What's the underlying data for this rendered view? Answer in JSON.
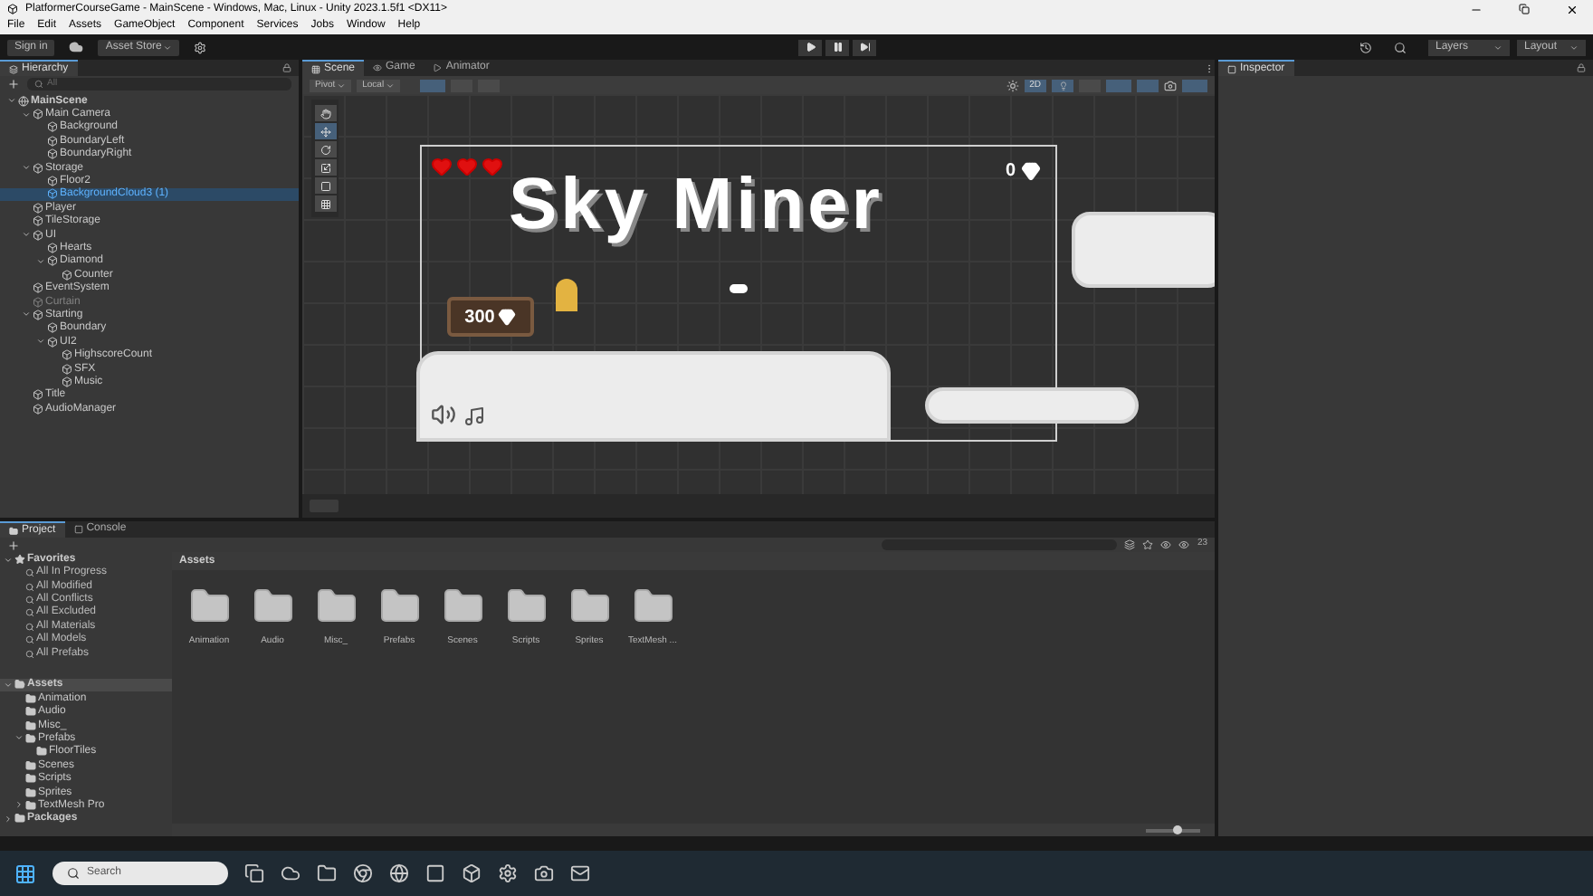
{
  "window": {
    "title": "PlatformerCourseGame - MainScene - Windows, Mac, Linux - Unity 2023.1.5f1 <DX11>"
  },
  "menu": [
    "File",
    "Edit",
    "Assets",
    "GameObject",
    "Component",
    "Services",
    "Jobs",
    "Window",
    "Help"
  ],
  "toolbar": {
    "sign_in": "Sign in",
    "asset_store": "Asset Store",
    "layers": "Layers",
    "layout": "Layout"
  },
  "hierarchy": {
    "tab": "Hierarchy",
    "search_placeholder": "All",
    "tree": [
      {
        "name": "MainScene",
        "kind": "scene",
        "expanded": true,
        "selected": false,
        "active": true,
        "children": [
          {
            "name": "Main Camera",
            "expanded": true,
            "selected": false,
            "active": true,
            "children": [
              {
                "name": "Background",
                "selected": false,
                "active": true
              },
              {
                "name": "BoundaryLeft",
                "selected": false,
                "active": true
              },
              {
                "name": "BoundaryRight",
                "selected": false,
                "active": true
              }
            ]
          },
          {
            "name": "Storage",
            "expanded": true,
            "selected": false,
            "active": true,
            "children": [
              {
                "name": "Floor2",
                "selected": false,
                "active": true
              },
              {
                "name": "BackgroundCloud3 (1)",
                "selected": true,
                "active": true
              }
            ]
          },
          {
            "name": "Player",
            "selected": false,
            "active": true
          },
          {
            "name": "TileStorage",
            "selected": false,
            "active": true
          },
          {
            "name": "UI",
            "expanded": true,
            "selected": false,
            "active": true,
            "children": [
              {
                "name": "Hearts",
                "selected": false,
                "active": true
              },
              {
                "name": "Diamond",
                "expanded": true,
                "selected": false,
                "active": true,
                "children": [
                  {
                    "name": "Counter",
                    "selected": false,
                    "active": true
                  }
                ]
              }
            ]
          },
          {
            "name": "EventSystem",
            "selected": false,
            "active": true
          },
          {
            "name": "Curtain",
            "selected": false,
            "active": false
          },
          {
            "name": "Starting",
            "expanded": true,
            "selected": false,
            "active": true,
            "children": [
              {
                "name": "Boundary",
                "selected": false,
                "active": true
              },
              {
                "name": "UI2",
                "expanded": true,
                "selected": false,
                "active": true,
                "children": [
                  {
                    "name": "HighscoreCount",
                    "selected": false,
                    "active": true
                  },
                  {
                    "name": "SFX",
                    "selected": false,
                    "active": true
                  },
                  {
                    "name": "Music",
                    "selected": false,
                    "active": true
                  }
                ]
              }
            ]
          },
          {
            "name": "Title",
            "selected": false,
            "active": true
          },
          {
            "name": "AudioManager",
            "selected": false,
            "active": true
          }
        ]
      }
    ]
  },
  "scene_tabs": [
    {
      "label": "Scene",
      "selected": true
    },
    {
      "label": "Game",
      "selected": false
    },
    {
      "label": "Animator",
      "selected": false
    }
  ],
  "scene_toolbar": {
    "pivot": "Pivot",
    "local": "Local",
    "mode": "2D"
  },
  "game": {
    "title": "Sky Miner",
    "gems": "0",
    "sign": "300"
  },
  "inspector": {
    "tab": "Inspector"
  },
  "project": {
    "tabs": [
      {
        "label": "Project",
        "selected": true
      },
      {
        "label": "Console",
        "selected": false
      }
    ],
    "favorites": {
      "label": "Favorites",
      "expanded": true,
      "items": [
        "All In Progress",
        "All Modified",
        "All Conflicts",
        "All Excluded",
        "All Materials",
        "All Models",
        "All Prefabs"
      ]
    },
    "tree": [
      {
        "name": "Assets",
        "expanded": true,
        "selected": true,
        "children": [
          {
            "name": "Animation",
            "selected": false
          },
          {
            "name": "Audio",
            "selected": false
          },
          {
            "name": "Misc_",
            "selected": false
          },
          {
            "name": "Prefabs",
            "expanded": true,
            "selected": false,
            "children": [
              {
                "name": "FloorTiles",
                "selected": false
              }
            ]
          },
          {
            "name": "Scenes",
            "selected": false
          },
          {
            "name": "Scripts",
            "selected": false
          },
          {
            "name": "Sprites",
            "selected": false
          },
          {
            "name": "TextMesh Pro",
            "expanded": false,
            "selected": false
          }
        ]
      },
      {
        "name": "Packages",
        "expanded": false,
        "selected": false
      }
    ],
    "breadcrumb": "Assets",
    "count": "23",
    "zoom": {
      "level": 0.6
    },
    "folders": [
      "Animation",
      "Audio",
      "Misc_",
      "Prefabs",
      "Scenes",
      "Scripts",
      "Sprites",
      "TextMesh ..."
    ]
  },
  "taskbar": {
    "search_placeholder": "Search"
  }
}
